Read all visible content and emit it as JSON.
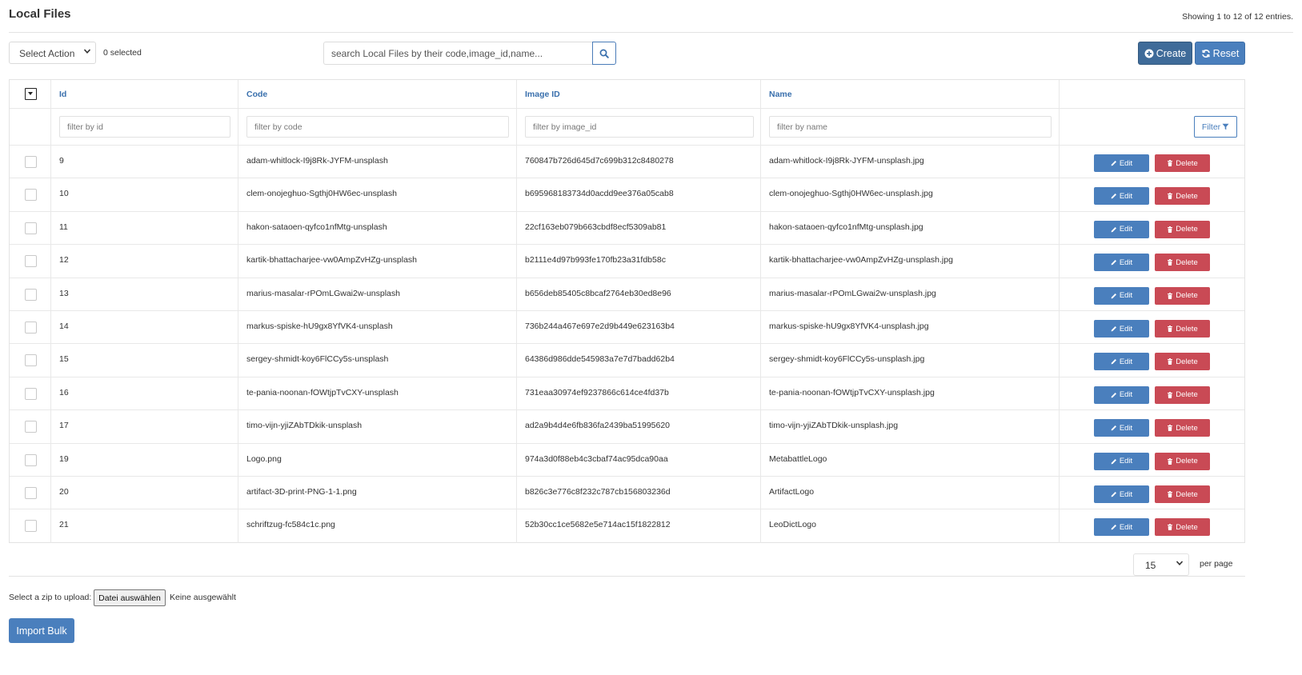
{
  "page": {
    "title": "Local Files",
    "entries_info": "Showing 1 to 12 of 12 entries."
  },
  "toolbar": {
    "select_action": "Select Action",
    "selected_count": "0 selected",
    "search_placeholder": "search Local Files by their code,image_id,name...",
    "create_label": "Create",
    "reset_label": "Reset"
  },
  "table": {
    "columns": [
      "Id",
      "Code",
      "Image ID",
      "Name"
    ],
    "filters": {
      "id": "filter by id",
      "code": "filter by code",
      "image_id": "filter by image_id",
      "name": "filter by name",
      "button": "Filter"
    },
    "edit_label": "Edit",
    "delete_label": "Delete",
    "rows": [
      {
        "id": "9",
        "code": "adam-whitlock-I9j8Rk-JYFM-unsplash",
        "image_id": "760847b726d645d7c699b312c8480278",
        "name": "adam-whitlock-I9j8Rk-JYFM-unsplash.jpg"
      },
      {
        "id": "10",
        "code": "clem-onojeghuo-Sgthj0HW6ec-unsplash",
        "image_id": "b695968183734d0acdd9ee376a05cab8",
        "name": "clem-onojeghuo-Sgthj0HW6ec-unsplash.jpg"
      },
      {
        "id": "11",
        "code": "hakon-sataoen-qyfco1nfMtg-unsplash",
        "image_id": "22cf163eb079b663cbdf8ecf5309ab81",
        "name": "hakon-sataoen-qyfco1nfMtg-unsplash.jpg"
      },
      {
        "id": "12",
        "code": "kartik-bhattacharjee-vw0AmpZvHZg-unsplash",
        "image_id": "b2111e4d97b993fe170fb23a31fdb58c",
        "name": "kartik-bhattacharjee-vw0AmpZvHZg-unsplash.jpg"
      },
      {
        "id": "13",
        "code": "marius-masalar-rPOmLGwai2w-unsplash",
        "image_id": "b656deb85405c8bcaf2764eb30ed8e96",
        "name": "marius-masalar-rPOmLGwai2w-unsplash.jpg"
      },
      {
        "id": "14",
        "code": "markus-spiske-hU9gx8YfVK4-unsplash",
        "image_id": "736b244a467e697e2d9b449e623163b4",
        "name": "markus-spiske-hU9gx8YfVK4-unsplash.jpg"
      },
      {
        "id": "15",
        "code": "sergey-shmidt-koy6FlCCy5s-unsplash",
        "image_id": "64386d986dde545983a7e7d7badd62b4",
        "name": "sergey-shmidt-koy6FlCCy5s-unsplash.jpg"
      },
      {
        "id": "16",
        "code": "te-pania-noonan-fOWtjpTvCXY-unsplash",
        "image_id": "731eaa30974ef9237866c614ce4fd37b",
        "name": "te-pania-noonan-fOWtjpTvCXY-unsplash.jpg"
      },
      {
        "id": "17",
        "code": "timo-vijn-yjiZAbTDkik-unsplash",
        "image_id": "ad2a9b4d4e6fb836fa2439ba51995620",
        "name": "timo-vijn-yjiZAbTDkik-unsplash.jpg"
      },
      {
        "id": "19",
        "code": "Logo.png",
        "image_id": "974a3d0f88eb4c3cbaf74ac95dca90aa",
        "name": "MetabattleLogo"
      },
      {
        "id": "20",
        "code": "artifact-3D-print-PNG-1-1.png",
        "image_id": "b826c3e776c8f232c787cb156803236d",
        "name": "ArtifactLogo"
      },
      {
        "id": "21",
        "code": "schriftzug-fc584c1c.png",
        "image_id": "52b30cc1ce5682e5e714ac15f1822812",
        "name": "LeoDictLogo"
      }
    ]
  },
  "pagination": {
    "per_page_value": "15",
    "per_page_label": "per page"
  },
  "upload": {
    "label": "Select a zip to upload:",
    "file_button": "Datei auswählen",
    "file_status": "Keine ausgewählt",
    "import_label": "Import Bulk"
  },
  "colors": {
    "primary": "#4a7fbd",
    "dark_primary": "#3f6b99",
    "danger": "#c94a55",
    "link": "#3a70ad"
  },
  "icons": {
    "search": "search-icon",
    "create": "plus-circle-icon",
    "reset": "refresh-icon",
    "filter": "funnel-icon",
    "edit": "pencil-icon",
    "delete": "trash-icon",
    "dropdown": "chevron-down-icon"
  }
}
